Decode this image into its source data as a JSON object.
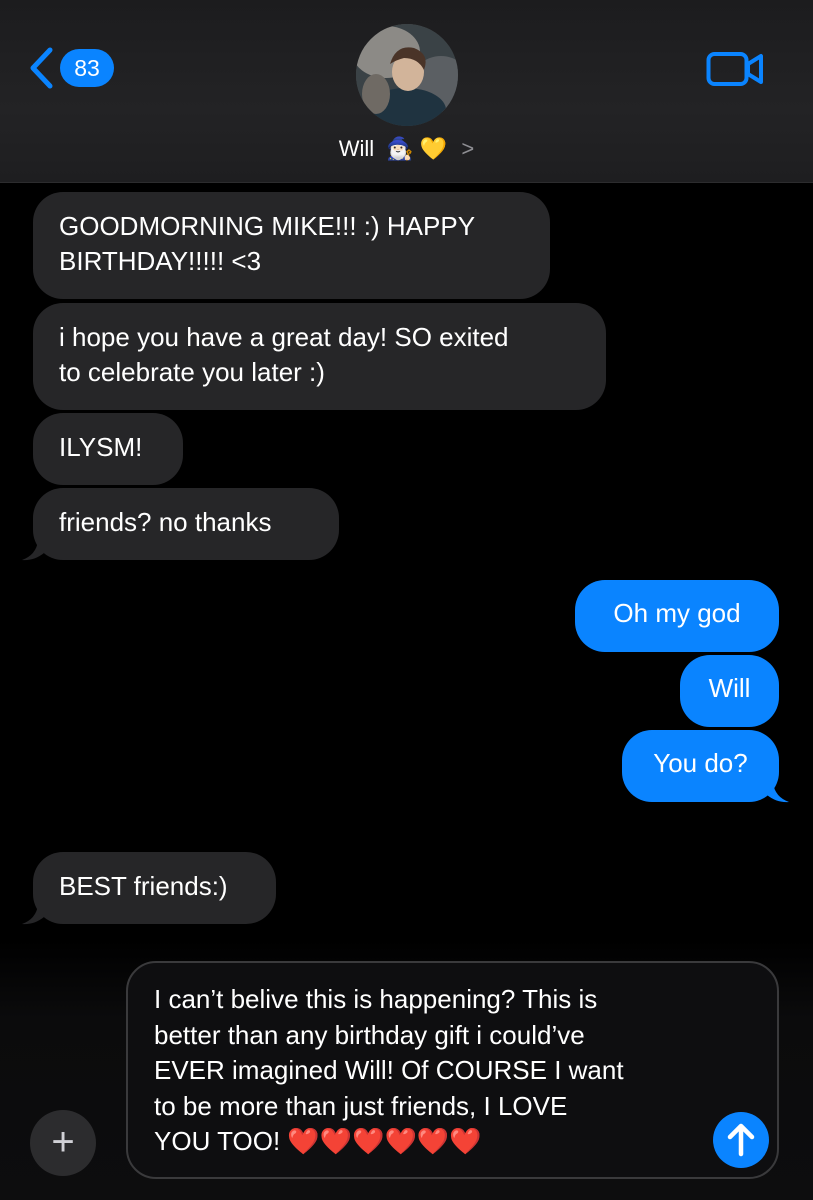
{
  "header": {
    "back_count": "83",
    "contact_name": "Will",
    "contact_emojis": "🧙🏻‍♂️ 💛",
    "chevron": ">"
  },
  "messages": [
    {
      "direction": "incoming",
      "text": "GOODMORNING MIKE!!! :) HAPPY\nBIRTHDAY!!!!! <3"
    },
    {
      "direction": "incoming",
      "text": "i hope you have a great day! SO exited\nto celebrate you later :)"
    },
    {
      "direction": "incoming",
      "text": "ILYSM!"
    },
    {
      "direction": "incoming",
      "text": "friends? no thanks"
    },
    {
      "direction": "outgoing",
      "text": "Oh my god"
    },
    {
      "direction": "outgoing",
      "text": "Will"
    },
    {
      "direction": "outgoing",
      "text": "You do?"
    },
    {
      "direction": "incoming",
      "text": "BEST friends:)"
    }
  ],
  "compose": {
    "text": "I can’t belive this is happening? This is\nbetter than any birthday gift i could’ve\nEVER imagined Will! Of COURSE I want\nto be more than just friends,  I LOVE\nYOU TOO!",
    "hearts": "❤️❤️❤️❤️❤️❤️",
    "plus_label": "+"
  },
  "colors": {
    "accent": "#0a84ff",
    "incoming_bubble": "#262628",
    "background": "#000000"
  },
  "icons": {
    "back": "chevron-left-icon",
    "video": "video-camera-icon",
    "send": "arrow-up-icon",
    "plus": "plus-icon"
  }
}
